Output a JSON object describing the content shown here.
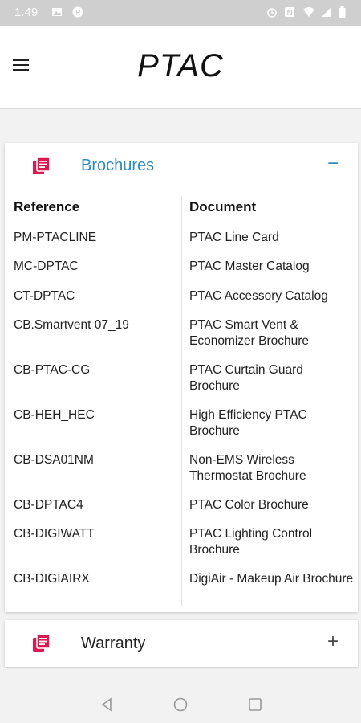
{
  "status_bar": {
    "time": "1:49",
    "icons": [
      "image-icon",
      "parking-icon",
      "alarm-icon",
      "nfc-icon",
      "wifi-icon",
      "signal-icon",
      "battery-icon"
    ]
  },
  "app_bar": {
    "title": "PTAC",
    "menu_icon": "hamburger-menu-icon"
  },
  "sections": [
    {
      "title": "Brochures",
      "expanded": true,
      "toggle": "−",
      "accent_color": "#2e8bc0",
      "icon_color": "#d81b50",
      "table": {
        "headers": [
          "Reference",
          "Document"
        ],
        "rows": [
          {
            "reference": "PM-PTACLINE",
            "document": "PTAC Line Card"
          },
          {
            "reference": "MC-DPTAC",
            "document": "PTAC Master Catalog"
          },
          {
            "reference": "CT-DPTAC",
            "document": "PTAC Accessory Catalog"
          },
          {
            "reference": "CB.Smartvent 07_19",
            "document": "PTAC Smart Vent & Economizer Brochure"
          },
          {
            "reference": "CB-PTAC-CG",
            "document": "PTAC Curtain Guard Brochure"
          },
          {
            "reference": "CB-HEH_HEC",
            "document": "High Efficiency PTAC Brochure"
          },
          {
            "reference": "CB-DSA01NM",
            "document": "Non-EMS Wireless Thermostat Brochure"
          },
          {
            "reference": "CB-DPTAC4",
            "document": "PTAC Color Brochure"
          },
          {
            "reference": "CB-DIGIWATT",
            "document": "PTAC Lighting Control Brochure"
          },
          {
            "reference": "CB-DIGIAIRX",
            "document": "DigiAir - Makeup Air Brochure"
          }
        ]
      }
    },
    {
      "title": "Warranty",
      "expanded": false,
      "toggle": "+",
      "accent_color": "#222222",
      "icon_color": "#d81b50"
    }
  ],
  "nav_bar": {
    "buttons": [
      "back-icon",
      "home-icon",
      "recents-icon"
    ]
  }
}
